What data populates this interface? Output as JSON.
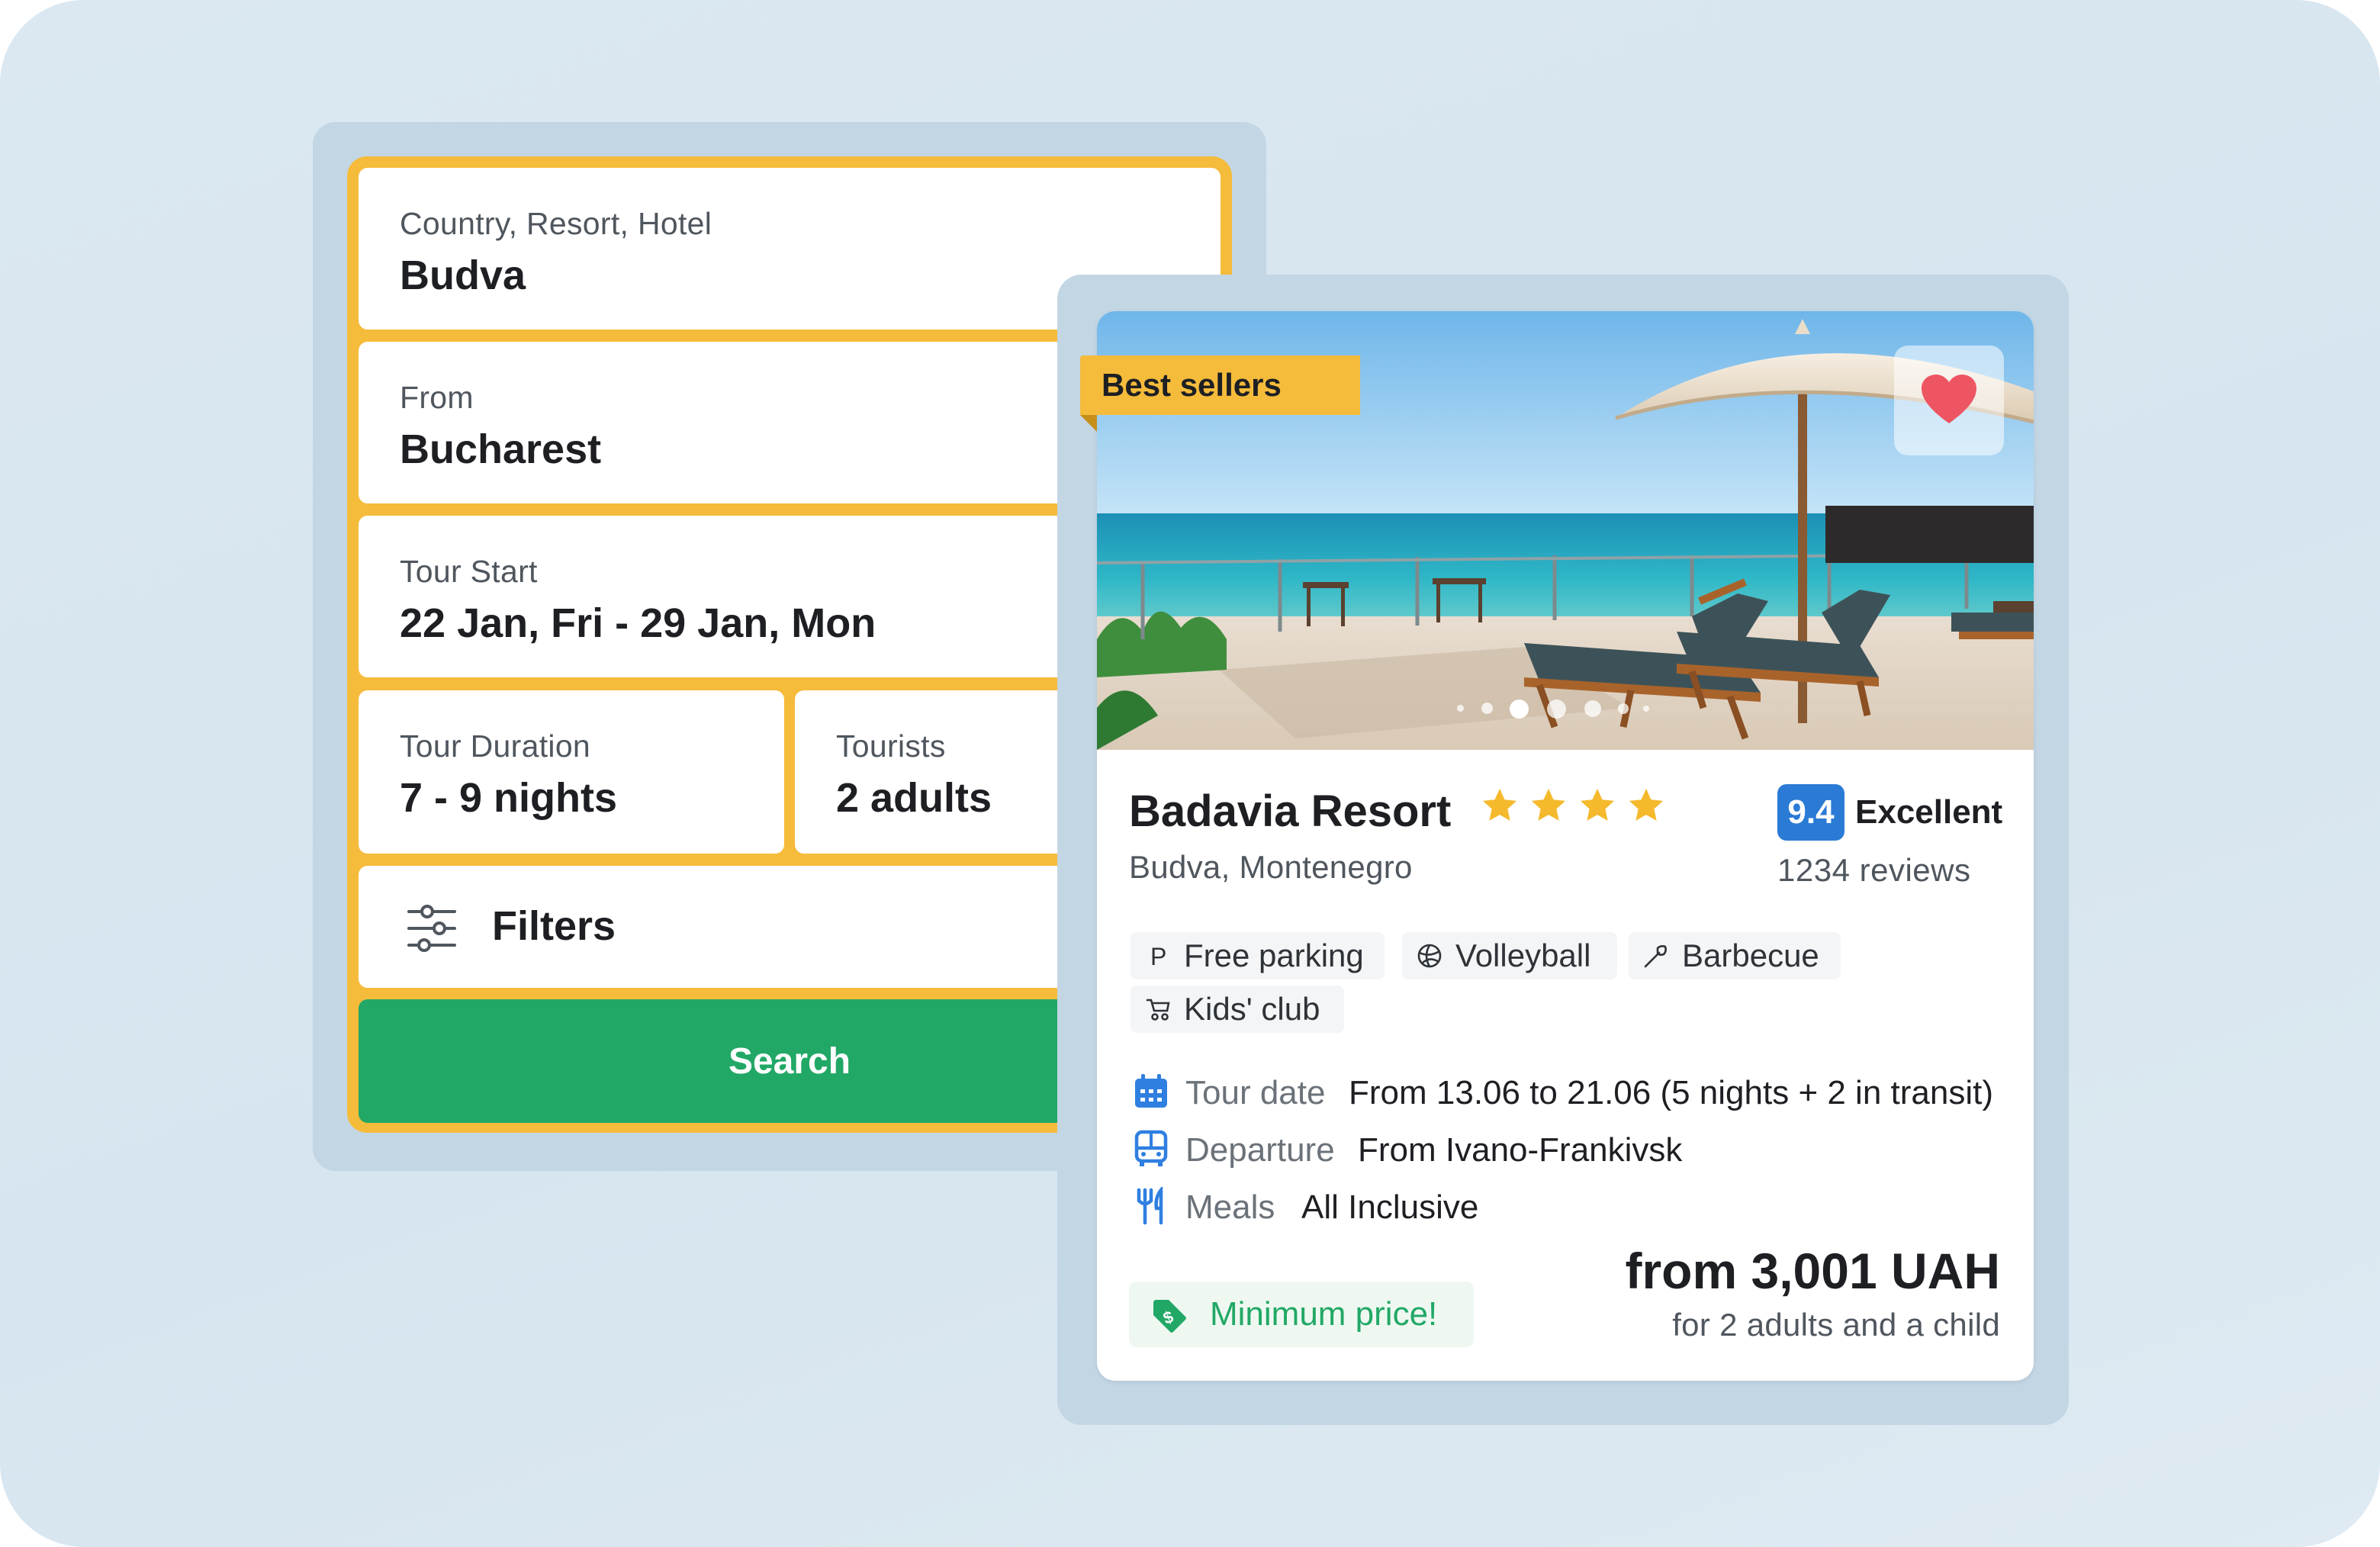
{
  "search_form": {
    "destination": {
      "label": "Country, Resort, Hotel",
      "value": "Budva"
    },
    "from": {
      "label": "From",
      "value": "Bucharest"
    },
    "tour_start": {
      "label": "Tour Start",
      "value": "22 Jan, Fri - 29 Jan, Mon"
    },
    "tour_duration": {
      "label": "Tour Duration",
      "value": "7 - 9 nights"
    },
    "tourists": {
      "label": "Tourists",
      "value": "2 adults"
    },
    "filters_label": "Filters",
    "search_label": "Search"
  },
  "hotel_card": {
    "ribbon": "Best sellers",
    "name": "Badavia Resort",
    "stars": 4,
    "location": "Budva, Montenegro",
    "rating": {
      "score": "9.4",
      "word": "Excellent",
      "reviews": "1234 reviews"
    },
    "amenities": [
      {
        "label": "Free parking",
        "icon": "parking-icon"
      },
      {
        "label": "Volleyball",
        "icon": "volleyball-icon"
      },
      {
        "label": "Barbecue",
        "icon": "barbecue-icon"
      },
      {
        "label": "Kids' club",
        "icon": "stroller-icon"
      }
    ],
    "details": {
      "tour_date": {
        "key": "Tour date",
        "value": "From 13.06 to 21.06 (5 nights + 2 in transit)"
      },
      "departure": {
        "key": "Departure",
        "value": "From Ivano-Frankivsk"
      },
      "meals": {
        "key": "Meals",
        "value": "All Inclusive"
      }
    },
    "min_price_badge": "Minimum price!",
    "price": "from 3,001 UAH",
    "price_note": "for 2 adults and a child",
    "gallery": {
      "total_images": 7,
      "active_index": 2
    }
  },
  "colors": {
    "accent_yellow": "#f5bb3b",
    "search_green": "#22a866",
    "rating_blue": "#2b7bd6",
    "icon_blue": "#2f7fe0",
    "star_yellow": "#f5b92c",
    "heart_red": "#ee5563"
  }
}
